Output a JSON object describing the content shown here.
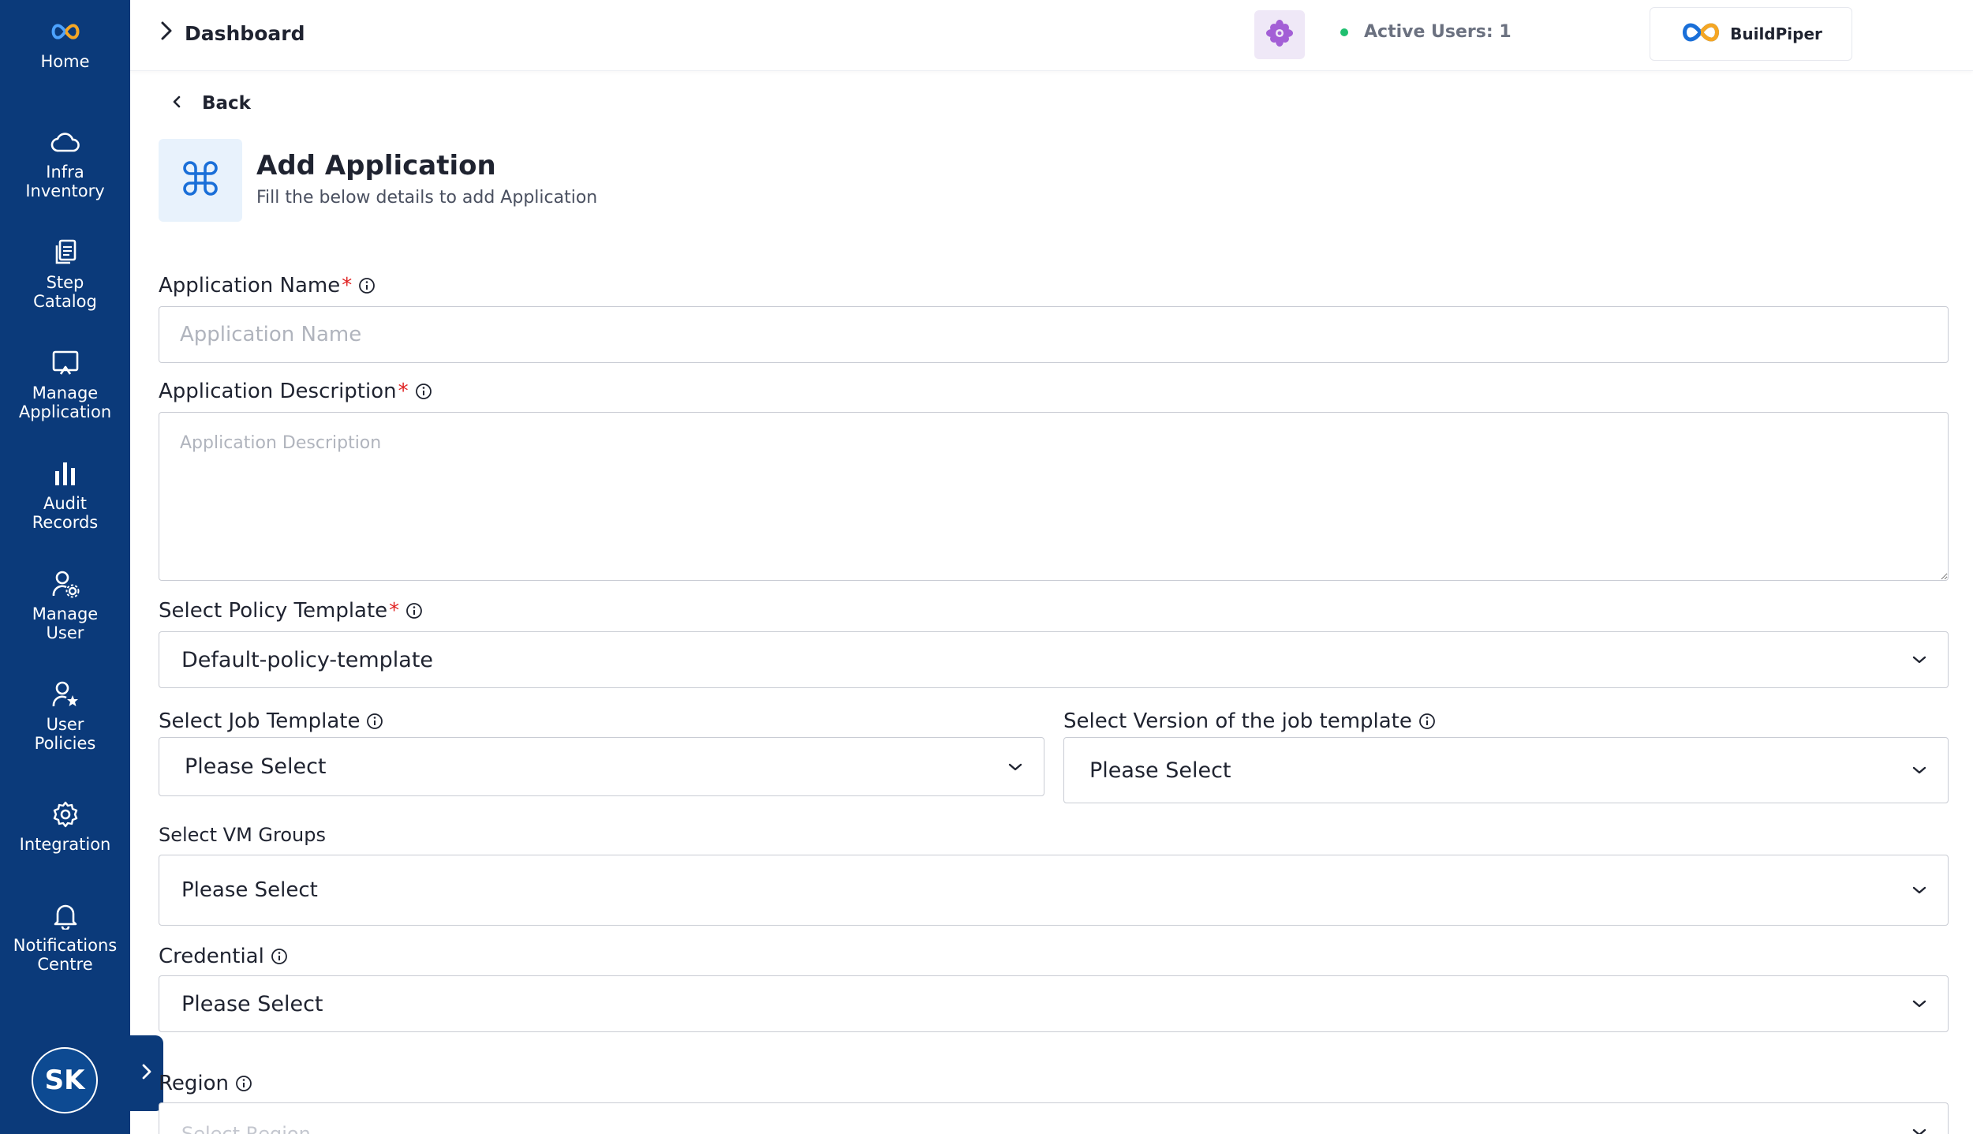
{
  "sidebar": {
    "items": [
      {
        "label": "Home",
        "icon": "buildpiper-logo-icon"
      },
      {
        "label": "Infra\nInventory",
        "icon": "cloud-icon"
      },
      {
        "label": "Step\nCatalog",
        "icon": "copy-icon"
      },
      {
        "label": "Manage\nApplication",
        "icon": "monitor-icon"
      },
      {
        "label": "Audit\nRecords",
        "icon": "bar-chart-icon"
      },
      {
        "label": "Manage\nUser",
        "icon": "user-gear-icon"
      },
      {
        "label": "User\nPolicies",
        "icon": "user-star-icon"
      },
      {
        "label": "Integration",
        "icon": "gear-icon"
      },
      {
        "label": "Notifications\nCentre",
        "icon": "bell-icon"
      }
    ],
    "avatar_initials": "SK"
  },
  "header": {
    "breadcrumb": "Dashboard",
    "active_users": "Active Users: 1",
    "brand": "BuildPiper"
  },
  "page": {
    "back_label": "Back",
    "title": "Add Application",
    "subtitle": "Fill the below details to add Application"
  },
  "form": {
    "app_name": {
      "label": "Application Name",
      "required": "*",
      "placeholder": "Application Name",
      "value": ""
    },
    "app_description": {
      "label": "Application Description",
      "required": "*",
      "placeholder": "Application Description",
      "value": ""
    },
    "policy_template": {
      "label": "Select Policy Template",
      "required": "*",
      "value": "Default-policy-template"
    },
    "job_template": {
      "label": "Select Job Template",
      "value": "Please Select"
    },
    "job_template_version": {
      "label": "Select Version of the job template",
      "value": "Please Select"
    },
    "vm_groups": {
      "label": "Select VM Groups",
      "value": "Please Select"
    },
    "credential": {
      "label": "Credential",
      "value": "Please Select"
    },
    "region": {
      "label": "Region",
      "placeholder": "Select Region"
    }
  },
  "colors": {
    "sidebar_bg": "#0b3a7a",
    "accent_blue": "#1a6fd8",
    "active_green": "#1fbf6f",
    "required_red": "#e02424"
  }
}
